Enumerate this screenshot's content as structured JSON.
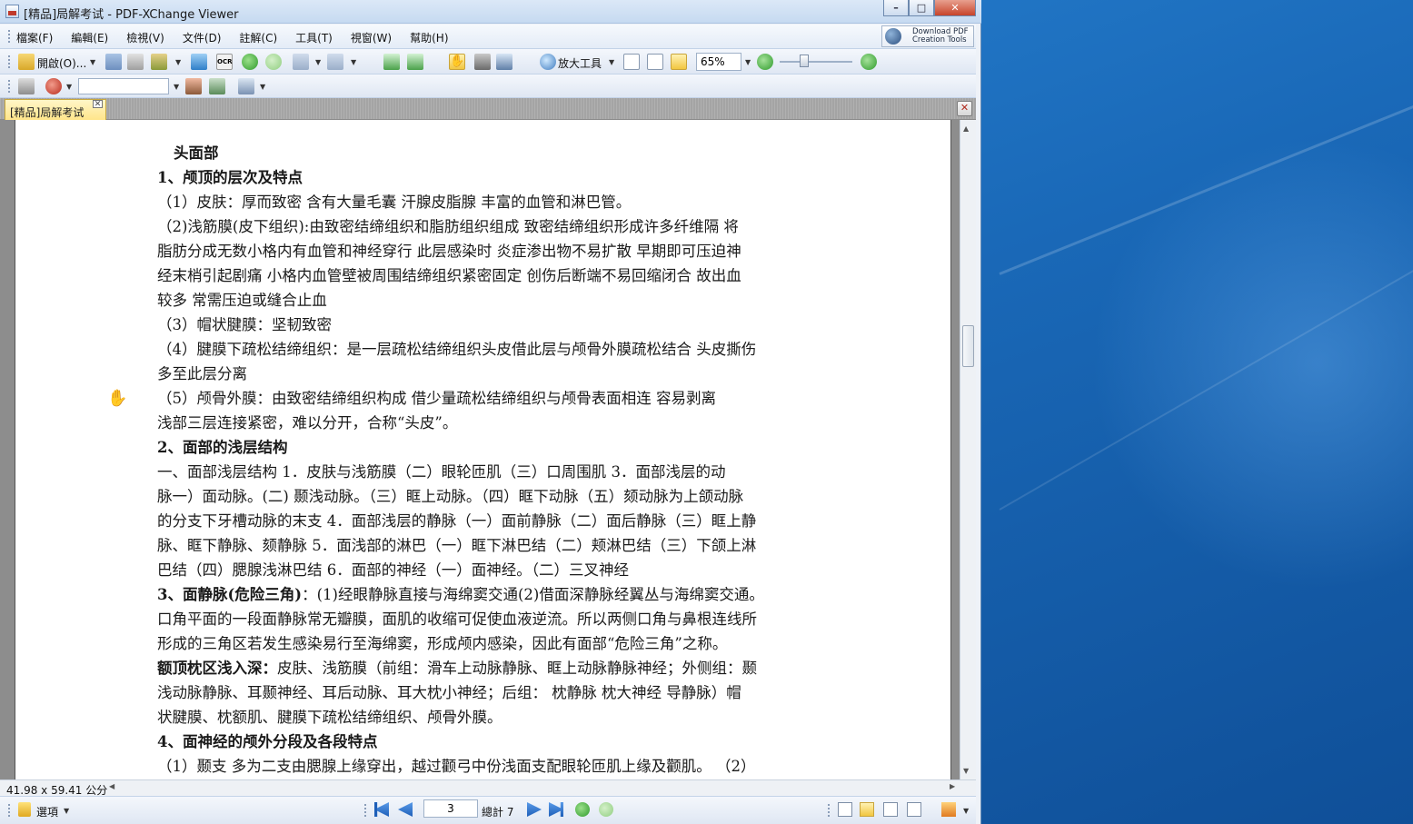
{
  "window": {
    "title": "[精品]局解考试 - PDF-XChange Viewer",
    "minimize": "–",
    "maximize": "□",
    "close": "✕"
  },
  "menu": {
    "items": [
      "檔案(F)",
      "編輯(E)",
      "檢視(V)",
      "文件(D)",
      "註解(C)",
      "工具(T)",
      "視窗(W)",
      "幫助(H)"
    ],
    "download_line1": "Download PDF",
    "download_line2": "Creation Tools"
  },
  "toolbar": {
    "open_label": "開啟(O)...",
    "zoom_tool_label": "放大工具",
    "zoom_value": "65%",
    "search_value": ""
  },
  "tabs": {
    "doc_tab_label": "[精品]局解考试",
    "tab_close": "✕"
  },
  "document": {
    "lines": [
      {
        "cls": "sub",
        "text": "头面部"
      },
      {
        "cls": "h",
        "text": "1、颅顶的层次及特点"
      },
      {
        "cls": "",
        "text": "（1）皮肤：厚而致密  含有大量毛囊  汗腺皮脂腺  丰富的血管和淋巴管。"
      },
      {
        "cls": "",
        "text": "（2)浅筋膜(皮下组织):由致密结缔组织和脂肪组织组成  致密结缔组织形成许多纤维隔  将"
      },
      {
        "cls": "",
        "text": "脂肪分成无数小格内有血管和神经穿行  此层感染时  炎症渗出物不易扩散  早期即可压迫神"
      },
      {
        "cls": "",
        "text": "经末梢引起剧痛  小格内血管壁被周围结缔组织紧密固定  创伤后断端不易回缩闭合  故出血"
      },
      {
        "cls": "",
        "text": "较多  常需压迫或缝合止血"
      },
      {
        "cls": "",
        "text": "（3）帽状腱膜：坚韧致密"
      },
      {
        "cls": "",
        "text": "（4）腱膜下疏松结缔组织：是一层疏松结缔组织头皮借此层与颅骨外膜疏松结合  头皮撕伤"
      },
      {
        "cls": "",
        "text": "多至此层分离"
      },
      {
        "cls": "",
        "text": "（5）颅骨外膜：由致密结缔组织构成  借少量疏松结缔组织与颅骨表面相连  容易剥离"
      },
      {
        "cls": "",
        "text": "浅部三层连接紧密，难以分开，合称“头皮”。"
      },
      {
        "cls": "h",
        "text": "2、面部的浅层结构"
      },
      {
        "cls": "",
        "text": "一、面部浅层结构      1．皮肤与浅筋膜（二）眼轮匝肌（三）口周围肌  3．面部浅层的动"
      },
      {
        "cls": "",
        "text": "脉一）面动脉。(二)  颞浅动脉。（三）眶上动脉。（四）眶下动脉（五）颏动脉为上颌动脉"
      },
      {
        "cls": "",
        "text": "的分支下牙槽动脉的末支 4．面部浅层的静脉（一）面前静脉（二）面后静脉（三）眶上静"
      },
      {
        "cls": "",
        "text": "脉、眶下静脉、颏静脉 5．面浅部的淋巴（一）眶下淋巴结（二）颊淋巴结（三）下颌上淋"
      },
      {
        "cls": "",
        "text": "巴结（四）腮腺浅淋巴结 6．面部的神经（一）面神经。（二）三叉神经"
      },
      {
        "cls": "mixed",
        "bold": "3、面静脉(危险三角)",
        "text": "：(1)经眼静脉直接与海绵窦交通(2)借面深静脉经翼丛与海绵窦交通。"
      },
      {
        "cls": "",
        "text": "口角平面的一段面静脉常无瓣膜，面肌的收缩可促使血液逆流。所以两侧口角与鼻根连线所"
      },
      {
        "cls": "",
        "text": "形成的三角区若发生感染易行至海绵窦，形成颅内感染，因此有面部“危险三角”之称。"
      },
      {
        "cls": "mixed",
        "bold": "额顶枕区浅入深：",
        "text": "皮肤、浅筋膜（前组：滑车上动脉静脉、眶上动脉静脉神经；外侧组：颞"
      },
      {
        "cls": "",
        "text": "浅动脉静脉、耳颞神经、耳后动脉、耳大枕小神经；后组：  枕静脉  枕大神经  导静脉）帽"
      },
      {
        "cls": "",
        "text": "状腱膜、枕额肌、腱膜下疏松结缔组织、颅骨外膜。"
      },
      {
        "cls": "h",
        "text": "4、面神经的颅外分段及各段特点"
      },
      {
        "cls": "",
        "text": "（1）颞支  多为二支由腮腺上缘穿出，越过颧弓中份浅面支配眼轮匝肌上缘及颧肌。    （2）"
      }
    ]
  },
  "status": {
    "dimensions": "41.98 x 59.41 公分"
  },
  "bottom": {
    "options_label": "選項",
    "page_value": "3",
    "total_label": "總計 7"
  }
}
